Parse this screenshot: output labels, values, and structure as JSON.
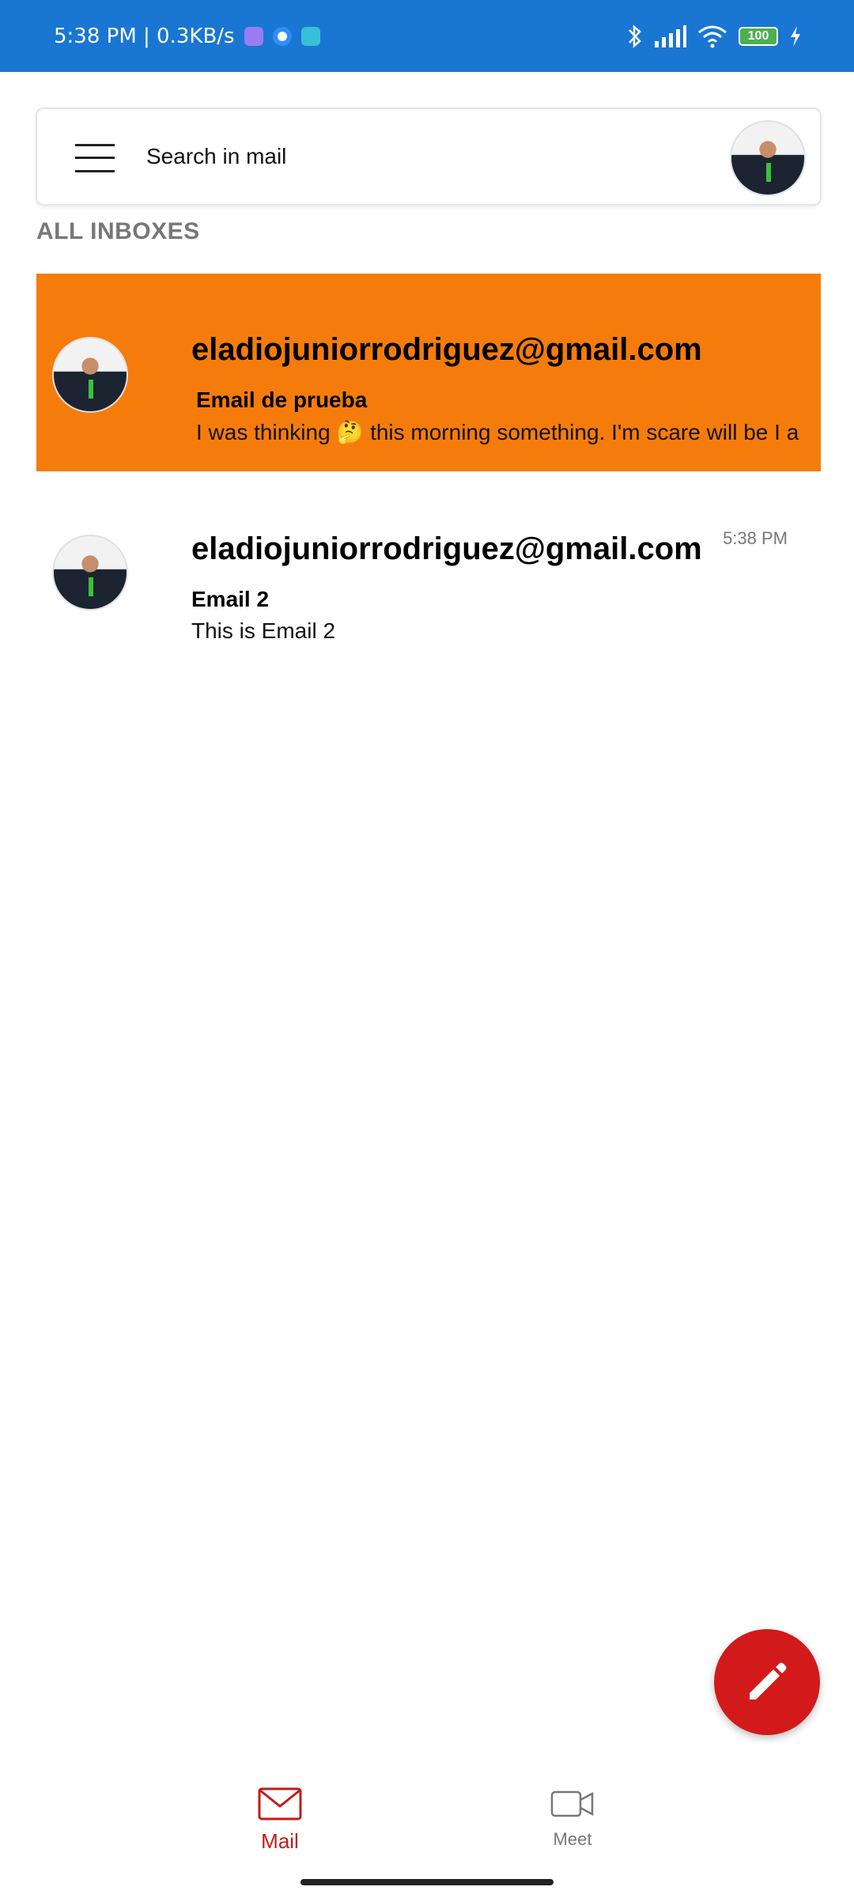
{
  "status_bar": {
    "time_speed": "5:38 PM | 0.3KB/s",
    "battery": "100",
    "icons": [
      "notification-purple-icon",
      "notification-blue-icon",
      "notification-teal-icon",
      "bluetooth-icon",
      "signal-icon",
      "wifi-icon",
      "battery-icon",
      "charging-icon"
    ]
  },
  "search": {
    "placeholder": "Search in mail",
    "menu_icon": "hamburger-menu-icon",
    "avatar_icon": "profile-avatar"
  },
  "section": {
    "title": "ALL INBOXES"
  },
  "mails": [
    {
      "sender": "eladiojuniorrodriguez@gmail.com",
      "subject": "Email de prueba",
      "snippet": "I was thinking 🤔 this morning something. I'm scare will be I a",
      "time": "",
      "selected": true
    },
    {
      "sender": "eladiojuniorrodriguez@gmail.com",
      "subject": "Email 2",
      "snippet": "This is Email 2",
      "time": "5:38 PM",
      "selected": false
    }
  ],
  "fab": {
    "icon": "pencil-icon"
  },
  "bottom_nav": {
    "items": [
      {
        "label": "Mail",
        "icon": "mail-icon",
        "active": true
      },
      {
        "label": "Meet",
        "icon": "video-camera-icon",
        "active": false
      }
    ]
  },
  "colors": {
    "status_bar": "#1976d2",
    "selected_mail": "#f57c0b",
    "fab": "#d31a1a",
    "active_nav": "#c41a1a"
  }
}
